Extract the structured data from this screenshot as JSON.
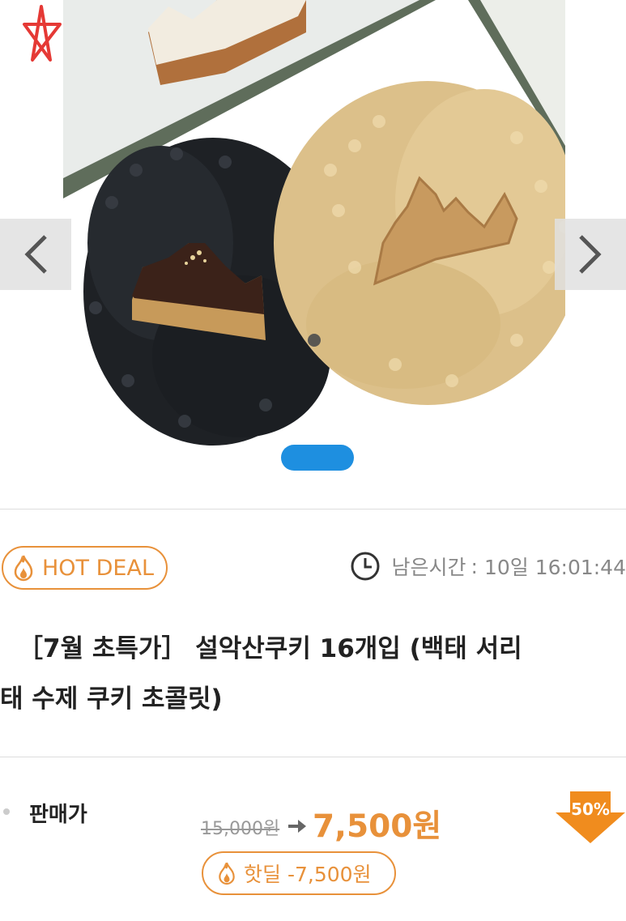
{
  "gallery": {
    "prev_icon": "chevron-left-icon",
    "next_icon": "chevron-right-icon",
    "indicator_color": "#1e8fe0"
  },
  "deal": {
    "badge_label": "HOT DEAL",
    "badge_icon": "flame-icon",
    "timer_label": "남은시간",
    "timer_sep": ":",
    "timer_value": "10일 16:01:44",
    "timer_icon": "clock-icon"
  },
  "product": {
    "title_line1": "［7월 초특가］ 설악산쿠키 16개입 (백태 서리",
    "title_line2": "태 수제 쿠키 초콜릿)"
  },
  "price": {
    "label": "판매가",
    "original": "15,000원",
    "sale": "7,500원",
    "discount": "50%",
    "hotdeal_label": "핫딜 -7,500원"
  },
  "colors": {
    "accent": "#e8913a",
    "indicator": "#1e8fe0",
    "text": "#222222"
  }
}
